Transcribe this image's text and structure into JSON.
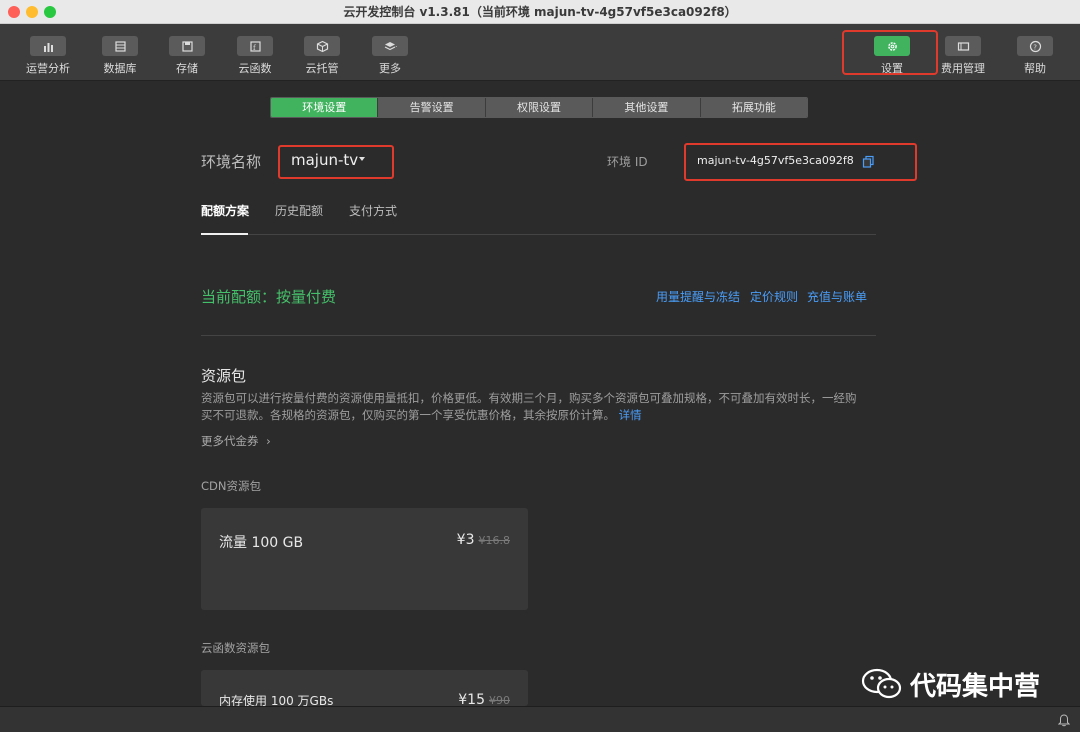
{
  "window": {
    "title": "云开发控制台 v1.3.81（当前环境 majun-tv-4g57vf5e3ca092f8）"
  },
  "toolbar": {
    "items": [
      {
        "label": "运营分析",
        "icon": "bar-chart-icon"
      },
      {
        "label": "数据库",
        "icon": "database-icon"
      },
      {
        "label": "存储",
        "icon": "save-icon"
      },
      {
        "label": "云函数",
        "icon": "function-icon"
      },
      {
        "label": "云托管",
        "icon": "cube-icon"
      },
      {
        "label": "更多",
        "icon": "layers-icon"
      },
      {
        "label": "设置",
        "icon": "gear-icon"
      },
      {
        "label": "费用管理",
        "icon": "billing-icon"
      },
      {
        "label": "帮助",
        "icon": "help-icon"
      }
    ],
    "active": "设置"
  },
  "tabs": [
    {
      "label": "环境设置",
      "active": true
    },
    {
      "label": "告警设置",
      "active": false
    },
    {
      "label": "权限设置",
      "active": false
    },
    {
      "label": "其他设置",
      "active": false
    },
    {
      "label": "拓展功能",
      "active": false
    }
  ],
  "env": {
    "name_label": "环境名称",
    "name_value": "majun-tv",
    "id_label": "环境 ID",
    "id_value": "majun-tv-4g57vf5e3ca092f8"
  },
  "subtabs": [
    {
      "label": "配额方案",
      "active": true
    },
    {
      "label": "历史配额",
      "active": false
    },
    {
      "label": "支付方式",
      "active": false
    }
  ],
  "plan": {
    "current": "当前配额：按量付费",
    "links": [
      "用量提醒与冻结",
      "定价规则",
      "充值与账单"
    ]
  },
  "resources": {
    "title": "资源包",
    "description_line1": "资源包可以进行按量付费的资源使用量抵扣，价格更低。有效期三个月，购买多个资源包可叠加规格，不可叠加有效时长，一经购",
    "description_line2": "买不可退款。各规格的资源包，仅购买的第一个享受优惠价格，其余按原价计算。",
    "details_link": "详情",
    "more_coupons": "更多代金券",
    "cdn_section": "CDN资源包",
    "cdn_card": {
      "title": "流量 100 GB",
      "price": "¥3",
      "original_price": "¥16.8"
    },
    "func_section": "云函数资源包",
    "func_card": {
      "title": "内存使用 100 万GBs",
      "price": "¥15",
      "original_price": "¥90"
    }
  },
  "watermark": {
    "text": "代码集中营"
  },
  "colors": {
    "accent_green": "#41b35f",
    "highlight_red": "#e03a2c",
    "link_blue": "#4a9df8",
    "background": "#2b2b2b"
  }
}
